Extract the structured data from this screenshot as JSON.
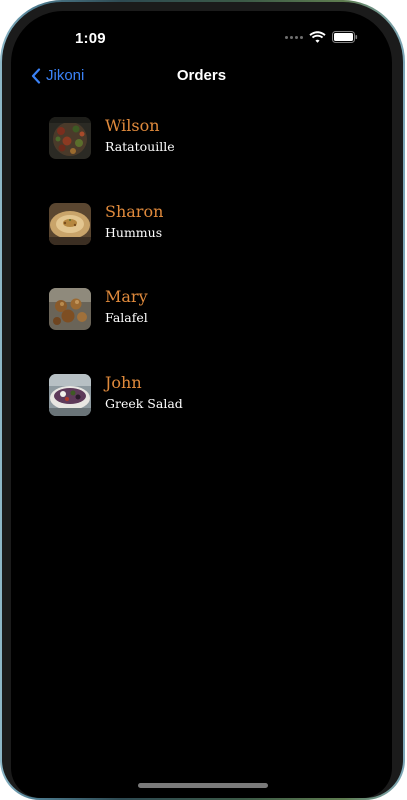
{
  "status_bar": {
    "time": "1:09",
    "wifi_icon": "wifi-icon",
    "battery_icon": "battery-icon"
  },
  "nav": {
    "back_label": "Jikoni",
    "title": "Orders"
  },
  "orders": [
    {
      "customer": "Wilson",
      "dish": "Ratatouille",
      "thumb_icon": "ratatouille-photo"
    },
    {
      "customer": "Sharon",
      "dish": "Hummus",
      "thumb_icon": "hummus-photo"
    },
    {
      "customer": "Mary",
      "dish": "Falafel",
      "thumb_icon": "falafel-photo"
    },
    {
      "customer": "John",
      "dish": "Greek Salad",
      "thumb_icon": "greek-salad-photo"
    }
  ],
  "colors": {
    "accent_blue": "#3b82f6",
    "name_orange": "#e08a3c",
    "background": "#000000",
    "text_white": "#ffffff"
  }
}
